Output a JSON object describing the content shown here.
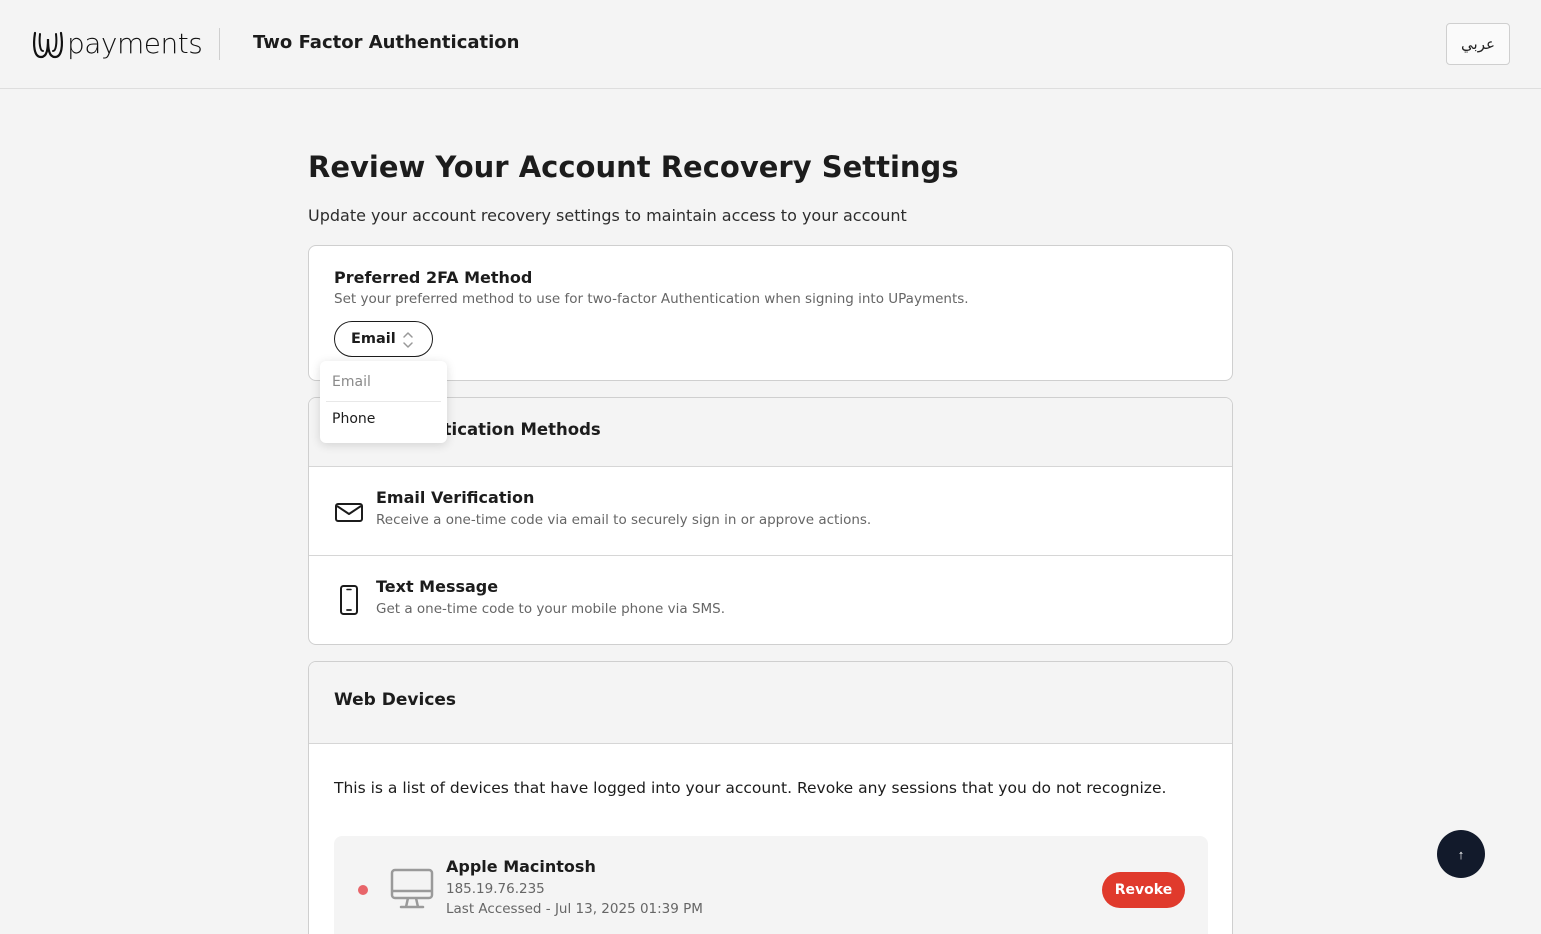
{
  "header": {
    "brand": "payments",
    "title": "Two Factor Authentication",
    "language_button": "عربي"
  },
  "page": {
    "title": "Review Your Account Recovery Settings",
    "subtitle": "Update your account recovery settings to maintain access to your account"
  },
  "preferred_2fa": {
    "title": "Preferred 2FA Method",
    "description": "Set your preferred method to use for two-factor Authentication when signing into UPayments.",
    "selected": "Email",
    "options": [
      "Email",
      "Phone"
    ]
  },
  "auth_methods": {
    "title": "Authentication Methods",
    "title_visible": "thentication Methods",
    "items": [
      {
        "icon": "envelope-icon",
        "title": "Email Verification",
        "description": "Receive a one-time code via email to securely sign in or approve actions."
      },
      {
        "icon": "mobile-phone-icon",
        "title": "Text Message",
        "description": "Get a one-time code to your mobile phone via SMS."
      }
    ]
  },
  "web_devices": {
    "title": "Web Devices",
    "description": "This is a list of devices that have logged into your account. Revoke any sessions that you do not recognize.",
    "devices": [
      {
        "icon": "desktop-monitor-icon",
        "name": "Apple Macintosh",
        "ip": "185.19.76.235",
        "last_accessed": "Last Accessed - Jul 13, 2025 01:39 PM",
        "action": "Revoke",
        "status_color": "#e8656a"
      }
    ]
  },
  "scroll_top": {
    "icon": "arrow-up-icon",
    "glyph": "↑"
  },
  "colors": {
    "background": "#f4f4f4",
    "revoke": "#e03a2c",
    "scroll_top": "#121a2b"
  }
}
